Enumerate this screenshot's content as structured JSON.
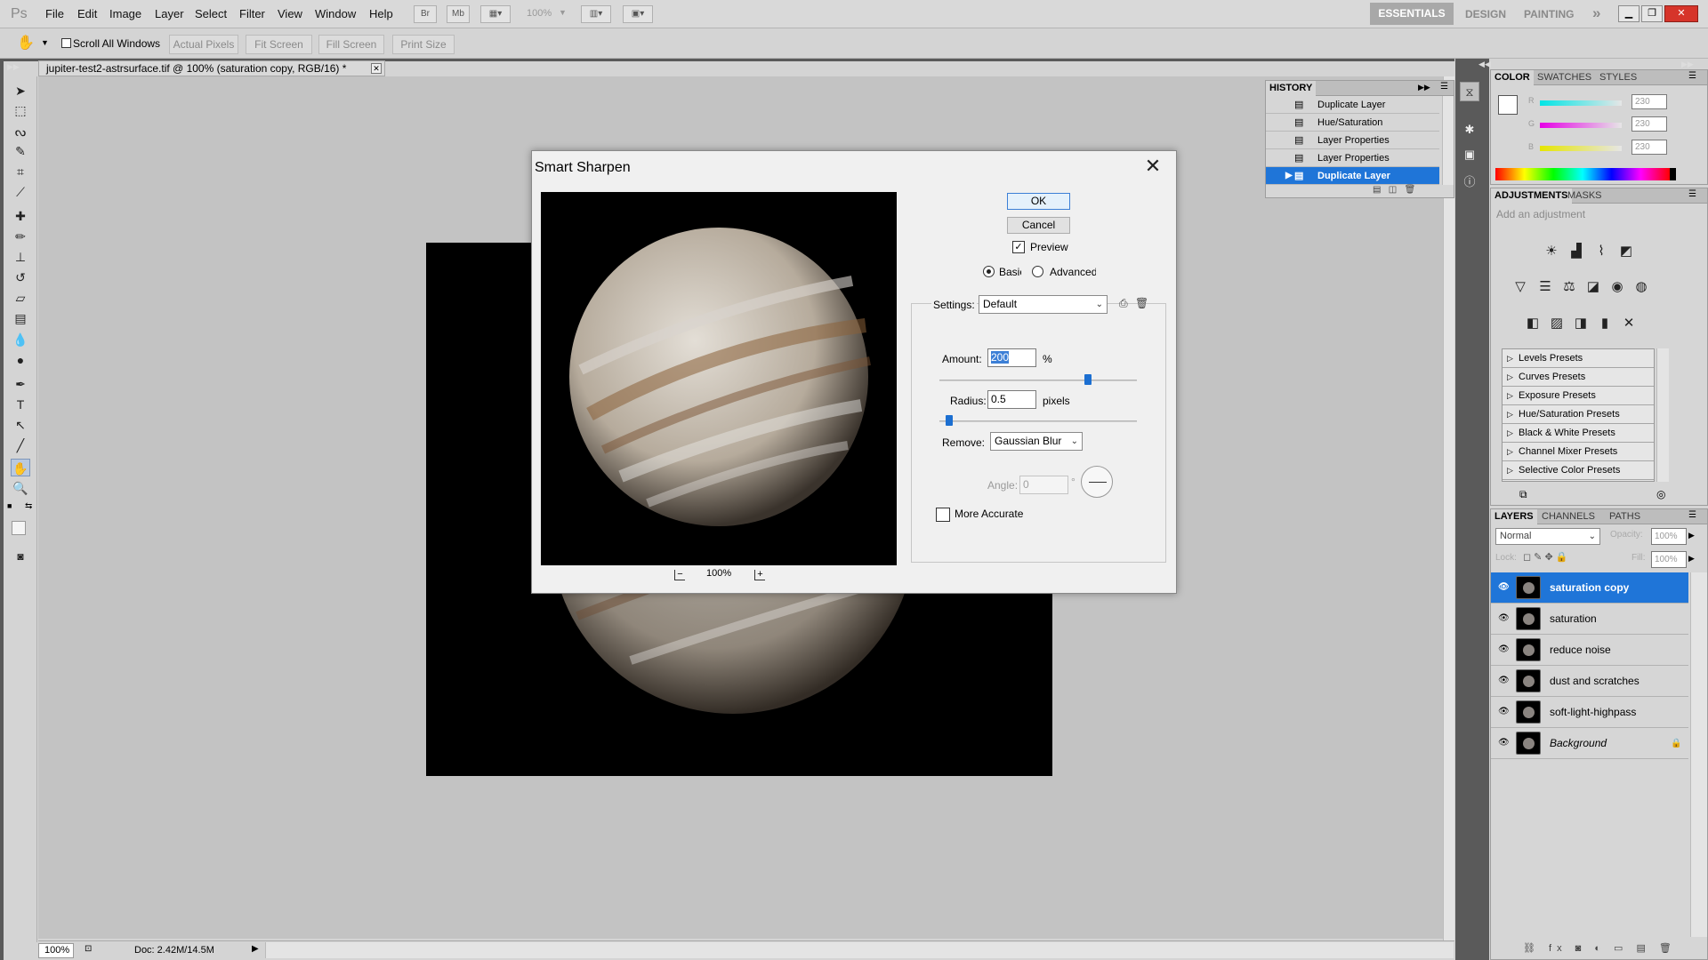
{
  "app": {
    "logo": "Ps"
  },
  "menu": [
    "File",
    "Edit",
    "Image",
    "Layer",
    "Select",
    "Filter",
    "View",
    "Window",
    "Help"
  ],
  "menubar": {
    "zoom_value": "100%",
    "workspaces": [
      "ESSENTIALS",
      "DESIGN",
      "PAINTING"
    ],
    "more": "»"
  },
  "options": {
    "scroll_all_windows": "Scroll All Windows",
    "buttons": [
      "Actual Pixels",
      "Fit Screen",
      "Fill Screen",
      "Print Size"
    ]
  },
  "document": {
    "tab_title": "jupiter-test2-astrsurface.tif @ 100% (saturation copy, RGB/16) *"
  },
  "status": {
    "zoom": "100%",
    "doc": "Doc: 2.42M/14.5M"
  },
  "dialog": {
    "title": "Smart Sharpen",
    "ok": "OK",
    "cancel": "Cancel",
    "preview": "Preview",
    "basic": "Basic",
    "advanced": "Advanced",
    "settings_label": "Settings:",
    "settings_value": "Default",
    "amount_label": "Amount:",
    "amount_value": "200",
    "amount_unit": "%",
    "amount_level": 0.75,
    "radius_label": "Radius:",
    "radius_value": "0.5",
    "radius_unit": "pixels",
    "radius_level": 0.05,
    "remove_label": "Remove:",
    "remove_value": "Gaussian Blur",
    "angle_label": "Angle:",
    "angle_value": "0",
    "angle_unit": "°",
    "more_accurate": "More Accurate",
    "zoom": "100%",
    "zoom_out": "−",
    "zoom_in": "+"
  },
  "history": {
    "tab": "HISTORY",
    "items": [
      "Duplicate Layer",
      "Hue/Saturation",
      "Layer Properties",
      "Layer Properties",
      "Duplicate Layer"
    ],
    "selected_index": 4
  },
  "color": {
    "tabs": [
      "COLOR",
      "SWATCHES",
      "STYLES"
    ],
    "channels": [
      {
        "label": "R",
        "value": "230"
      },
      {
        "label": "G",
        "value": "230"
      },
      {
        "label": "B",
        "value": "230"
      }
    ]
  },
  "adjustments": {
    "tabs": [
      "ADJUSTMENTS",
      "MASKS"
    ],
    "hint": "Add an adjustment",
    "presets": [
      "Levels Presets",
      "Curves Presets",
      "Exposure Presets",
      "Hue/Saturation Presets",
      "Black & White Presets",
      "Channel Mixer Presets",
      "Selective Color Presets"
    ]
  },
  "layers": {
    "tabs": [
      "LAYERS",
      "CHANNELS",
      "PATHS"
    ],
    "blend_mode": "Normal",
    "opacity_label": "Opacity:",
    "opacity": "100%",
    "lock_label": "Lock:",
    "fill_label": "Fill:",
    "fill": "100%",
    "items": [
      "saturation copy",
      "saturation",
      "reduce noise",
      "dust and scratches",
      "soft-light-highpass",
      "Background"
    ],
    "selected_index": 0
  },
  "colors": {
    "accent": "#1f75d8",
    "essentials_bg": "#a8a8a8",
    "close_red": "#d6342a"
  }
}
